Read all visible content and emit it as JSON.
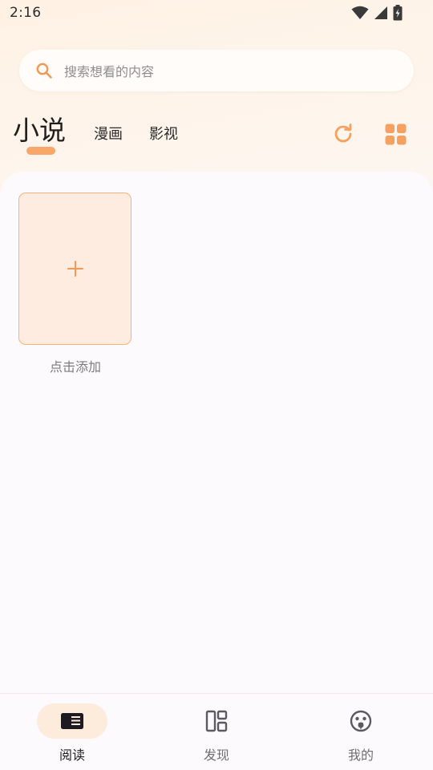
{
  "status_bar": {
    "time": "2:16"
  },
  "search": {
    "placeholder": "搜索想看的内容",
    "icon": "search-icon"
  },
  "tabs": [
    {
      "label": "小说",
      "active": true
    },
    {
      "label": "漫画",
      "active": false
    },
    {
      "label": "影视",
      "active": false
    }
  ],
  "toolbar": {
    "refresh_icon": "refresh-icon",
    "layout_icon": "grid-icon"
  },
  "library": {
    "add_label": "点击添加"
  },
  "bottom_nav": [
    {
      "label": "阅读",
      "icon": "book-icon",
      "active": true
    },
    {
      "label": "发现",
      "icon": "discover-icon",
      "active": false
    },
    {
      "label": "我的",
      "icon": "profile-icon",
      "active": false
    }
  ],
  "colors": {
    "accent": "#f9a66a",
    "card_fill": "#ffece0",
    "active_pill": "#fdebdc"
  }
}
